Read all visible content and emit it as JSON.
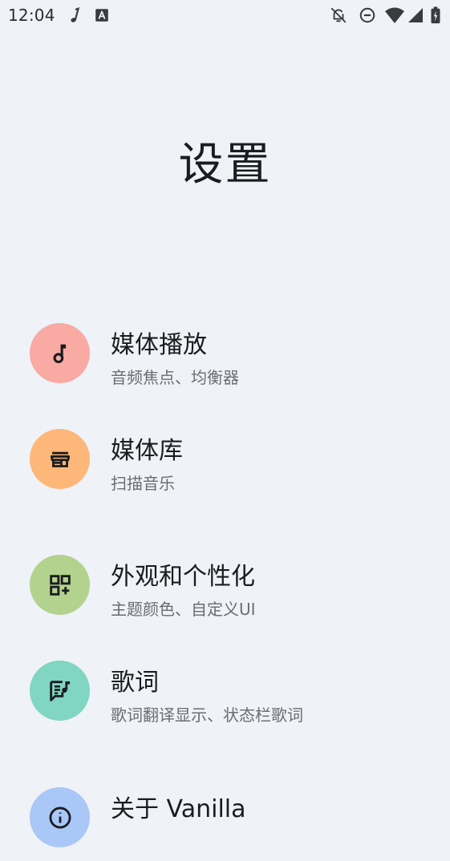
{
  "status_bar": {
    "time": "12:04",
    "icons": [
      "music-note-icon",
      "text-box-icon",
      "notifications-off-icon",
      "do-not-disturb-icon",
      "wifi-icon",
      "cellular-signal-icon",
      "battery-charging-icon"
    ]
  },
  "page": {
    "title": "设置"
  },
  "settings": {
    "items": [
      {
        "title": "媒体播放",
        "subtitle": "音频焦点、均衡器",
        "icon": "music-note-icon",
        "color": "#f8aaa3"
      },
      {
        "title": "媒体库",
        "subtitle": "扫描音乐",
        "icon": "storefront-icon",
        "color": "#fdb778"
      },
      {
        "title": "外观和个性化",
        "subtitle": "主题颜色、自定义UI",
        "icon": "widgets-add-icon",
        "color": "#b3d28e"
      },
      {
        "title": "歌词",
        "subtitle": "歌词翻译显示、状态栏歌词",
        "icon": "lyrics-icon",
        "color": "#80d5c3"
      },
      {
        "title": "关于 Vanilla",
        "subtitle": "",
        "icon": "info-icon",
        "color": "#a9c7f7"
      }
    ]
  },
  "colors": {
    "background": "#eff2f7",
    "text_primary": "#1b1c1f",
    "text_secondary": "#6a6d74"
  }
}
